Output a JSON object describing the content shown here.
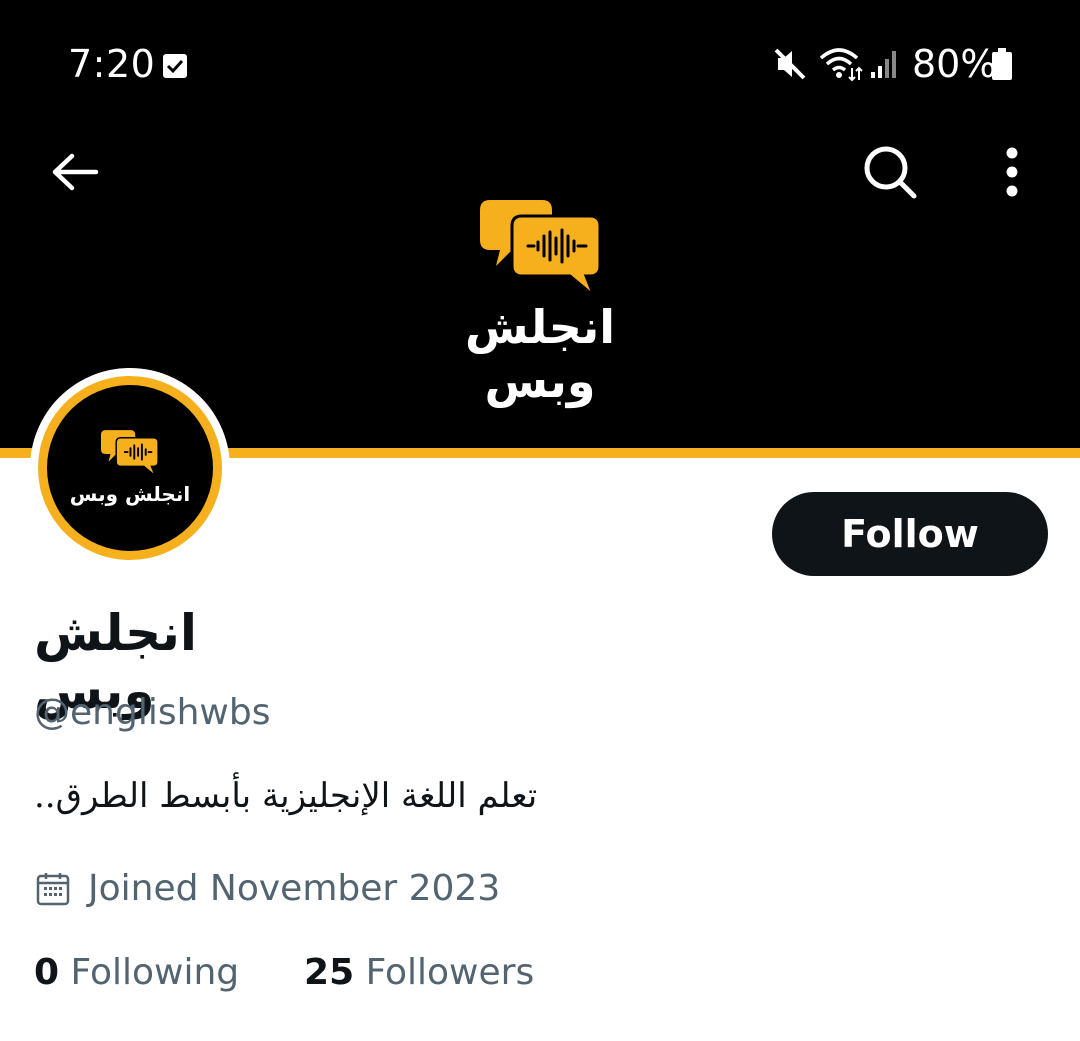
{
  "status_bar": {
    "time": "7:20",
    "battery_percent": "80%",
    "icons": [
      "checkbox-notification-icon",
      "mute-icon",
      "wifi-icon",
      "signal-icon",
      "battery-icon"
    ]
  },
  "header": {
    "back_icon": "back-arrow-icon",
    "search_icon": "search-icon",
    "more_icon": "more-vertical-icon"
  },
  "banner": {
    "title": "انجلش وبس",
    "background": "#000000",
    "accent": "#f6b01e"
  },
  "avatar": {
    "title": "انجلش وبس"
  },
  "profile": {
    "follow_label": "Follow",
    "display_name": "انجلش وبس",
    "handle": "@englishwbs",
    "bio": "تعلم اللغة الإنجليزية بأبسط الطرق..",
    "joined": "Joined November 2023",
    "following_count": "0",
    "following_label": "Following",
    "followers_count": "25",
    "followers_label": "Followers"
  },
  "colors": {
    "text_primary": "#0f1419",
    "text_secondary": "#536471",
    "button_bg": "#0f1419"
  }
}
